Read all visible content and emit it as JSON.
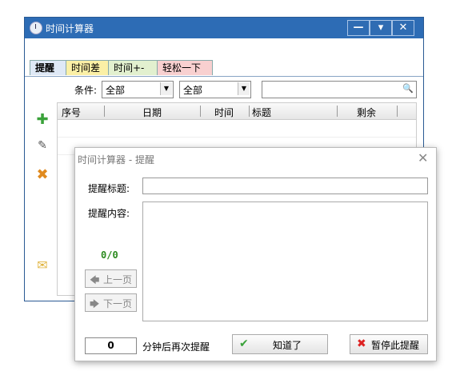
{
  "main_window": {
    "title": "时间计算器",
    "controls": [
      "—",
      "▾",
      "✕"
    ],
    "tabs": [
      {
        "label": "提醒",
        "color": "#dfe9f6"
      },
      {
        "label": "时间差",
        "color": "#fbf0a6"
      },
      {
        "label": "时间+-",
        "color": "#e2f0cf"
      },
      {
        "label": "轻松一下",
        "color": "#f8d0d0"
      }
    ],
    "filter_label": "条件:",
    "filter1_value": "全部",
    "filter2_value": "全部",
    "search_placeholder": "",
    "grid_headers": [
      "序号",
      "日期",
      "时间",
      "标题",
      "剩余"
    ],
    "side_buttons": [
      "add-icon",
      "edit-icon",
      "delete-icon",
      "message-icon"
    ]
  },
  "dialog": {
    "title": "时间计算器 - 提醒",
    "close": "✕",
    "title_label": "提醒标题:",
    "content_label": "提醒内容:",
    "counter": "0/0",
    "prev_label": "上一页",
    "next_label": "下一页",
    "minutes_value": "0",
    "minutes_label": "分钟后再次提醒",
    "ok_label": "知道了",
    "stop_label": "暂停此提醒"
  }
}
